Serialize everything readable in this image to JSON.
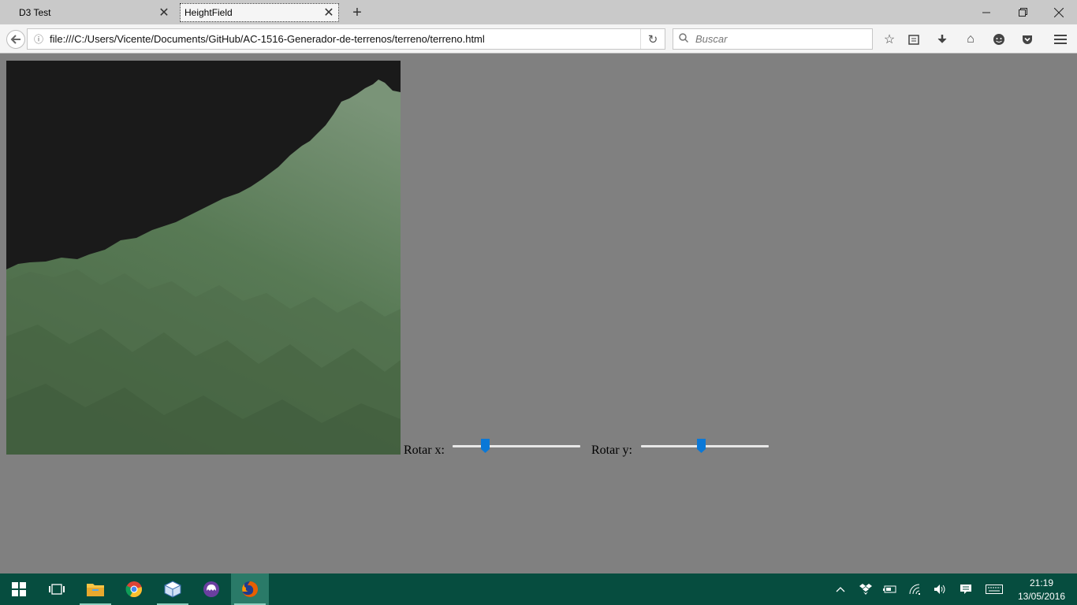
{
  "browser": {
    "tabs": [
      {
        "title": "D3 Test",
        "active": false
      },
      {
        "title": "HeightField",
        "active": true
      }
    ],
    "url": "file:///C:/Users/Vicente/Documents/GitHub/AC-1516-Generador-de-terrenos/terreno/terreno.html",
    "search_placeholder": "Buscar",
    "toolbar_icons": [
      "bookmark-star-icon",
      "reading-list-icon",
      "download-icon",
      "home-icon",
      "hello-chat-icon",
      "pocket-icon",
      "menu-icon"
    ]
  },
  "page": {
    "controls": [
      {
        "label": "Rotar x:",
        "value_fraction": 0.24
      },
      {
        "label": "Rotar y:",
        "value_fraction": 0.47
      }
    ],
    "colors": {
      "background": "#808080",
      "sky": "#1a1a1a",
      "terrain_light": "#7a9478",
      "terrain_dark": "#3d5839",
      "slider_thumb": "#0a78d7"
    }
  },
  "taskbar": {
    "apps": [
      "start-icon",
      "task-view-icon",
      "file-explorer-icon",
      "chrome-icon",
      "virtualbox-icon",
      "app-icon",
      "firefox-icon"
    ],
    "active_app": "firefox-icon",
    "time": "21:19",
    "date": "13/05/2016",
    "colors": {
      "taskbar": "#064d3f",
      "active": "#2a7a68"
    }
  }
}
